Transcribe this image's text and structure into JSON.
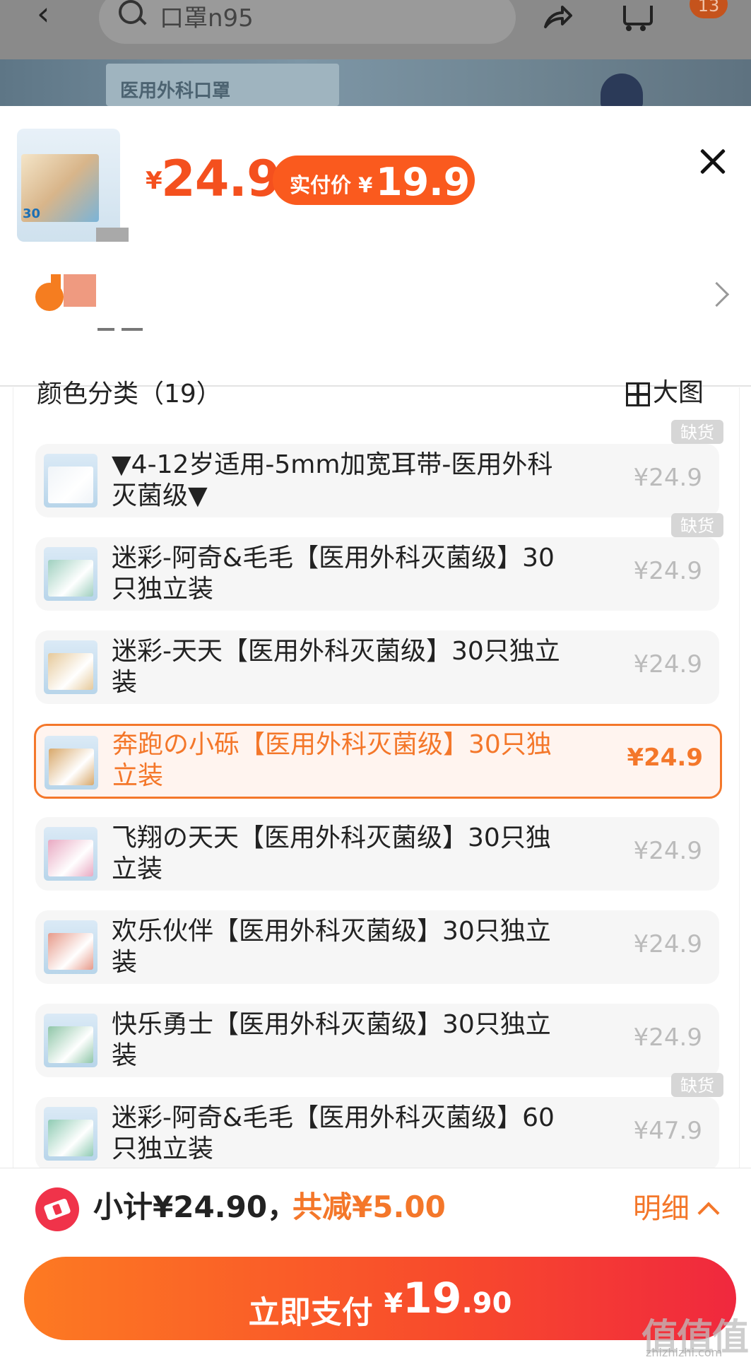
{
  "header": {
    "search_text": "口罩n95",
    "cart_badge": "13",
    "banner_text": "医用外科口罩"
  },
  "product": {
    "price_symbol": "¥",
    "price": "24.9",
    "paid_label": "实付价",
    "paid_symbol": "¥",
    "paid_value": "19.9",
    "thumb_count": "30"
  },
  "section": {
    "title": "颜色分类（19）",
    "big_image_label": "大图"
  },
  "options": [
    {
      "label": "▼4-12岁适用-5mm加宽耳带-医用外科灭菌级▼",
      "price": "¥24.9",
      "out_of_stock": "缺货",
      "selected": false,
      "color": "#f0f4f8"
    },
    {
      "label": "迷彩-阿奇&毛毛【医用外科灭菌级】30只独立装",
      "price": "¥24.9",
      "out_of_stock": "缺货",
      "selected": false,
      "color": "#9fd0bf"
    },
    {
      "label": "迷彩-天天【医用外科灭菌级】30只独立装",
      "price": "¥24.9",
      "out_of_stock": "",
      "selected": false,
      "color": "#e6c99a"
    },
    {
      "label": "奔跑の小砾【医用外科灭菌级】30只独立装",
      "price": "¥24.9",
      "out_of_stock": "",
      "selected": true,
      "color": "#d8a86a"
    },
    {
      "label": "飞翔の天天【医用外科灭菌级】30只独立装",
      "price": "¥24.9",
      "out_of_stock": "",
      "selected": false,
      "color": "#e9a9c2"
    },
    {
      "label": "欢乐伙伴【医用外科灭菌级】30只独立装",
      "price": "¥24.9",
      "out_of_stock": "",
      "selected": false,
      "color": "#e79a8a"
    },
    {
      "label": "快乐勇士【医用外科灭菌级】30只独立装",
      "price": "¥24.9",
      "out_of_stock": "",
      "selected": false,
      "color": "#8fc6a8"
    },
    {
      "label": "迷彩-阿奇&毛毛【医用外科灭菌级】60只独立装",
      "price": "¥47.9",
      "out_of_stock": "缺货",
      "selected": false,
      "color": "#8fcbb3"
    }
  ],
  "footer": {
    "subtotal": "小计¥24.90，",
    "discount": "共减¥5.00",
    "detail_label": "明细",
    "pay_label": "立即支付",
    "pay_symbol": "¥",
    "pay_int": "19",
    "pay_dec": ".90"
  },
  "watermark": {
    "logo": "值值值",
    "url": "zhizhizhi.com"
  }
}
